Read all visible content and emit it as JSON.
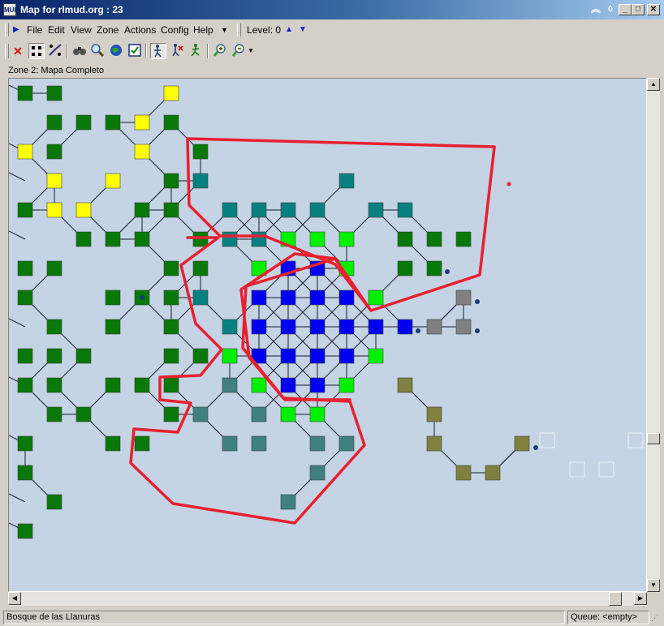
{
  "window": {
    "app_icon": "MUD",
    "title": "Map for rlmud.org : 23"
  },
  "menu": {
    "items": [
      "File",
      "Edit",
      "View",
      "Zone",
      "Actions",
      "Config",
      "Help"
    ],
    "level_label": "Level: 0"
  },
  "toolbar": {
    "icons": [
      "delete-icon",
      "room-mode-icon",
      "draw-mode-icon",
      "binoculars-icon",
      "find-icon",
      "globe-icon",
      "checkbox-icon",
      "walk-mode-icon",
      "speedwalk-icon",
      "run-icon",
      "zoom-in-icon",
      "zoom-out-icon"
    ]
  },
  "zone": {
    "name": "Zone 2: Mapa Completo"
  },
  "map": {
    "colors": {
      "background": "#c4d4e4",
      "dark_green": "#087808",
      "yellow": "#ffff00",
      "teal": "#088080",
      "slate": "#3f8080",
      "bright_green": "#00f000",
      "blue": "#0000f0",
      "gray": "#808080",
      "olive": "#80803f",
      "outline_red": "#e82030"
    }
  },
  "status": {
    "room_name": "Bosque de las Llanuras",
    "queue": "Queue: <empty>"
  }
}
